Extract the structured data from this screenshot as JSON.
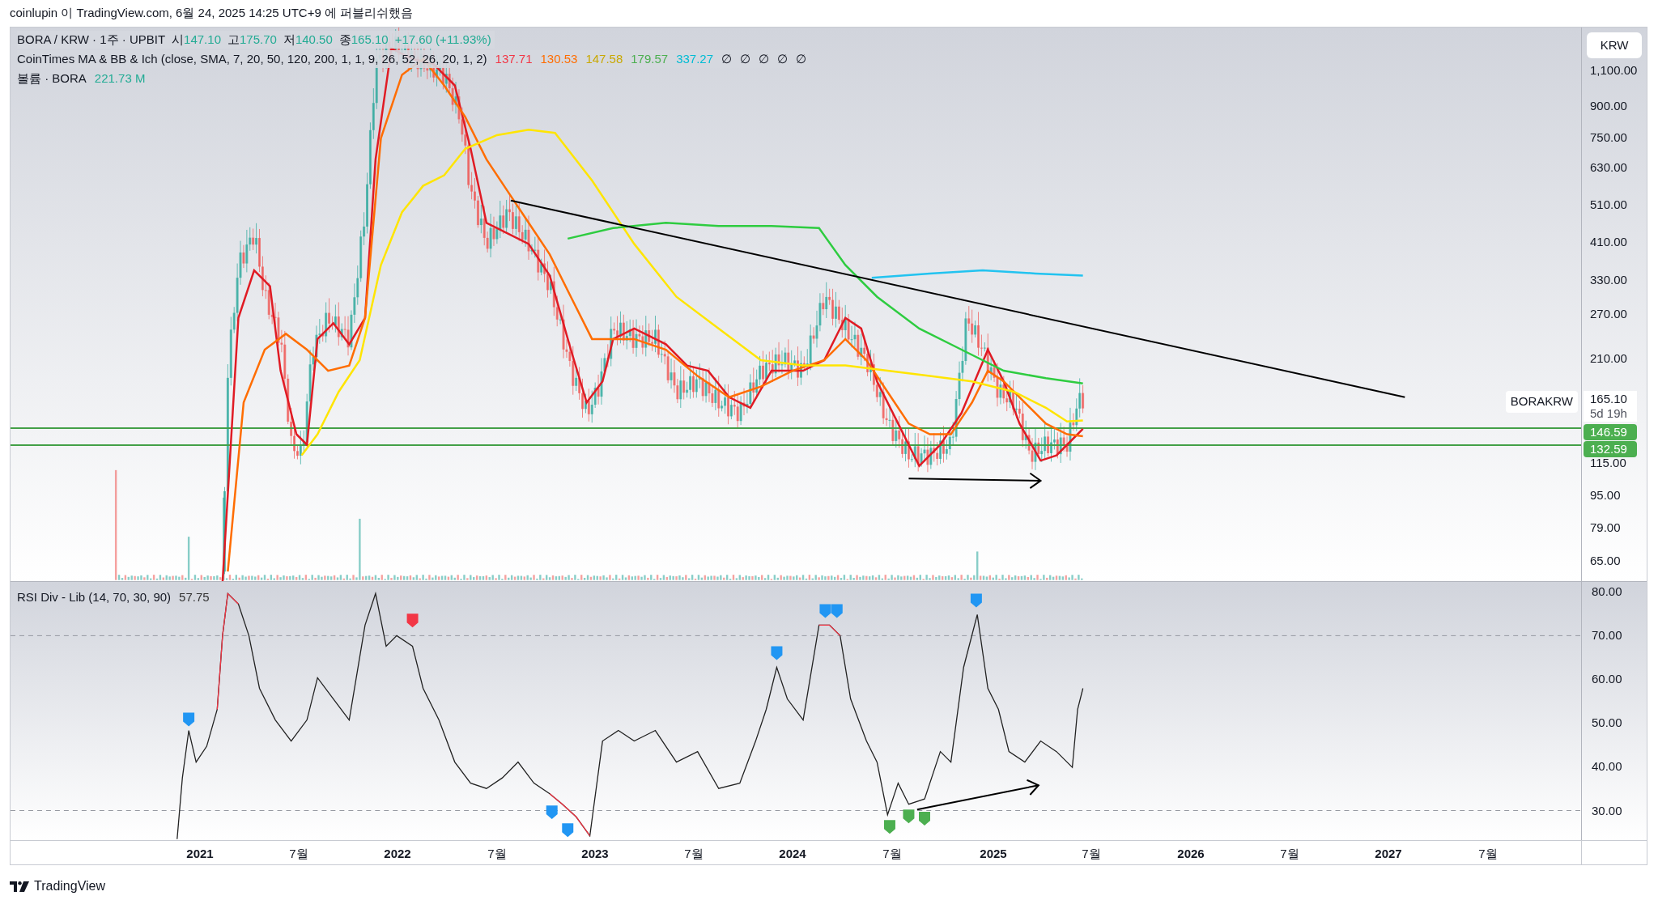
{
  "header": {
    "published": "coinlupin 이 TradingView.com, 6월 24, 2025 14:25 UTC+9 에 퍼블리쉬했음"
  },
  "legend": {
    "symbol": "BORA / KRW · 1주 · UPBIT",
    "ohlc": [
      {
        "label": "시",
        "value": "147.10"
      },
      {
        "label": "고",
        "value": "175.70"
      },
      {
        "label": "저",
        "value": "140.50"
      },
      {
        "label": "종",
        "value": "165.10"
      }
    ],
    "change": "+17.60 (+11.93%)",
    "indicator": {
      "name": "CoinTimes MA & BB & Ich (close, SMA, 7, 20, 50, 120, 200, 1, 1, 9, 26, 52, 26, 20, 1, 2)",
      "values": [
        {
          "value": "137.71",
          "color": "#f23645"
        },
        {
          "value": "130.53",
          "color": "#ff6d00"
        },
        {
          "value": "147.58",
          "color": "#c9a800"
        },
        {
          "value": "179.57",
          "color": "#4caf50"
        },
        {
          "value": "337.27",
          "color": "#00bcd4"
        }
      ],
      "empty_values": [
        "∅",
        "∅",
        "∅",
        "∅",
        "∅"
      ]
    },
    "volume": {
      "name": "볼륨 · BORA",
      "value": "221.73 M"
    }
  },
  "price_axis": {
    "currency": "KRW",
    "ticks": [
      "1,100.00",
      "900.00",
      "750.00",
      "630.00",
      "510.00",
      "410.00",
      "330.00",
      "270.00",
      "210.00",
      "115.00",
      "95.00",
      "79.00",
      "65.00"
    ],
    "symbol_tag": "BORAKRW",
    "last_price": "165.10",
    "countdown": "5d 19h",
    "level_tags": [
      "146.59",
      "132.59"
    ]
  },
  "rsi": {
    "title": "RSI Div - Lib (14, 70, 30, 90)",
    "value": "57.75",
    "ticks": [
      "80.00",
      "70.00",
      "60.00",
      "50.00",
      "40.00",
      "30.00"
    ]
  },
  "time_axis": {
    "labels": [
      {
        "text": "2021",
        "kind": "year"
      },
      {
        "text": "7월",
        "kind": "month"
      },
      {
        "text": "2022",
        "kind": "year"
      },
      {
        "text": "7월",
        "kind": "month"
      },
      {
        "text": "2023",
        "kind": "year"
      },
      {
        "text": "7월",
        "kind": "month"
      },
      {
        "text": "2024",
        "kind": "year"
      },
      {
        "text": "7월",
        "kind": "month"
      },
      {
        "text": "2025",
        "kind": "year"
      },
      {
        "text": "7월",
        "kind": "month"
      },
      {
        "text": "2026",
        "kind": "year"
      },
      {
        "text": "7월",
        "kind": "month"
      },
      {
        "text": "2027",
        "kind": "year"
      },
      {
        "text": "7월",
        "kind": "month"
      }
    ]
  },
  "footer": {
    "brand": "TradingView"
  }
}
